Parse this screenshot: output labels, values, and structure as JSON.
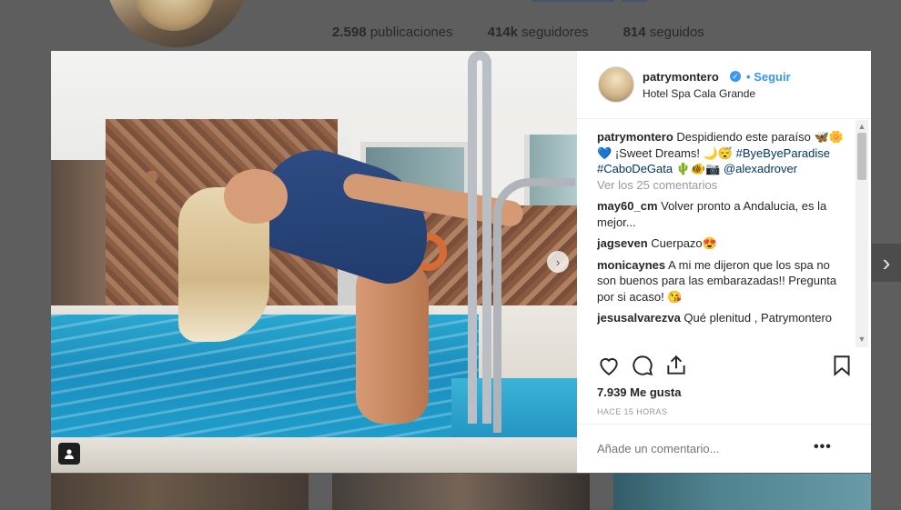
{
  "background_profile": {
    "posts_count": "2.598",
    "posts_label": "publicaciones",
    "followers_count": "414k",
    "followers_label": "seguidores",
    "following_count": "814",
    "following_label": "seguidos"
  },
  "next_arrow": "›",
  "photo": {
    "carousel_next": "›"
  },
  "post": {
    "username": "patrymontero",
    "verified_glyph": "✓",
    "separator": "•",
    "follow_label": "Seguir",
    "location": "Hotel Spa Cala Grande",
    "caption": {
      "user": "patrymontero",
      "text_1": "Despidiendo este paraíso",
      "emojis_1": "🦋🌼💙",
      "text_2": "¡Sweet Dreams!",
      "emojis_2": "🌙😴",
      "hashtags": "#ByeByeParadise #CaboDeGata",
      "emojis_3": "🌵🐠📷",
      "mention": "@alexadrover"
    },
    "view_all": "Ver los 25 comentarios",
    "comments": [
      {
        "user": "may60_cm",
        "text": "Volver pronto a Andalucia, es la mejor..."
      },
      {
        "user": "jagseven",
        "text": "Cuerpazo😍"
      },
      {
        "user": "monicaynes",
        "text": "A mi me dijeron que los spa no son buenos para las embarazadas!! Pregunta por si acaso! 😘"
      },
      {
        "user": "jesusalvarezva",
        "text": "Qué plenitud , Patrymontero"
      }
    ],
    "likes": "7.939 Me gusta",
    "time": "HACE 15 HORAS",
    "add_comment_placeholder": "Añade un comentario...",
    "more_options": "•••"
  },
  "icons": {
    "like": "heart-icon",
    "comment": "comment-icon",
    "share": "share-icon",
    "save": "bookmark-icon",
    "tag": "user-tag-icon"
  },
  "colors": {
    "link_blue": "#3897f0",
    "hashtag_blue": "#003569",
    "overlay_gray": "#5e5e5e"
  }
}
